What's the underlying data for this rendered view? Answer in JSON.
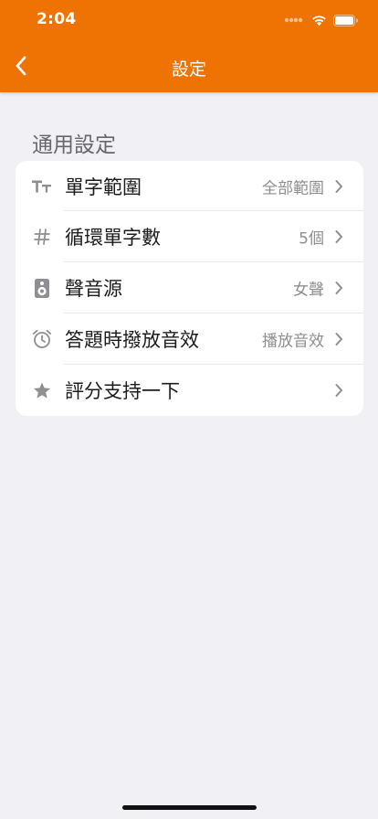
{
  "status_bar": {
    "time": "2:04"
  },
  "nav": {
    "title": "設定",
    "back_icon": "chevron-left-icon"
  },
  "section": {
    "title": "通用設定",
    "items": [
      {
        "label": "單字範圍",
        "value": "全部範圍",
        "icon": "text-size-icon"
      },
      {
        "label": "循環單字數",
        "value": "5個",
        "icon": "hashtag-icon"
      },
      {
        "label": "聲音源",
        "value": "女聲",
        "icon": "speaker-icon"
      },
      {
        "label": "答題時撥放音效",
        "value": "播放音效",
        "icon": "alarm-clock-icon"
      },
      {
        "label": "評分支持一下",
        "value": "",
        "icon": "star-icon"
      }
    ]
  },
  "colors": {
    "accent": "#ef7303",
    "background": "#f1f0f5",
    "card": "#ffffff",
    "secondary_text": "#8e8e93"
  }
}
